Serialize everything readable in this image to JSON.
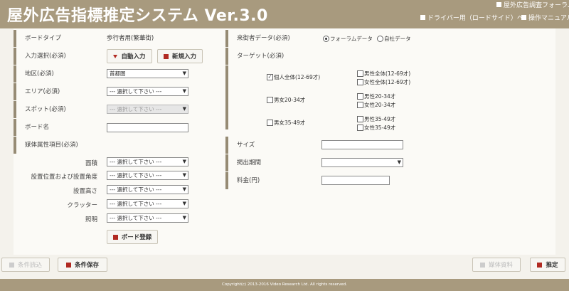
{
  "header": {
    "title": "屋外広告指標推定システム Ver.3.0",
    "link_forum": "屋外広告調査フォーラム",
    "link_driver": "ドライバー用（ロードサイド）へ",
    "link_manual": "操作マニュアル"
  },
  "form": {
    "board_type": {
      "label": "ボードタイプ",
      "value": "歩行者用(繁華街)"
    },
    "input_select": {
      "label": "入力選択(必須)",
      "auto_button": "自動入力",
      "new_button": "新規入力"
    },
    "region": {
      "label": "地区(必須)",
      "value": "首都圏"
    },
    "area": {
      "label": "エリア(必須)",
      "value": "--- 選択して下さい ---"
    },
    "spot": {
      "label": "スポット(必須)",
      "value": "--- 選択して下さい ---"
    },
    "board_name": {
      "label": "ボード名",
      "value": ""
    },
    "media_attrs": {
      "label": "媒体属性項目(必須)"
    },
    "attrs": [
      {
        "label": "面積",
        "value": "--- 選択して下さい ---"
      },
      {
        "label": "設置位置および設置角度",
        "value": "--- 選択して下さい ---"
      },
      {
        "label": "設置高さ",
        "value": "--- 選択して下さい ---"
      },
      {
        "label": "クラッター",
        "value": "--- 選択して下さい ---"
      },
      {
        "label": "照明",
        "value": "--- 選択して下さい ---"
      }
    ],
    "board_register_button": "ボード登録"
  },
  "right": {
    "traffic_data": {
      "label": "来街者データ(必須)",
      "options": [
        "フォーラムデータ",
        "自社データ"
      ],
      "selected": "フォーラムデータ"
    },
    "target": {
      "label": "ターゲット(必須)",
      "checkboxes": [
        {
          "label": "個人全体(12-69才)",
          "checked": true
        },
        {
          "label": "男性全体(12-69才)",
          "checked": false
        },
        {
          "label": "女性全体(12-69才)",
          "checked": false
        },
        {
          "label": "男女20-34才",
          "checked": false
        },
        {
          "label": "男性20-34才",
          "checked": false
        },
        {
          "label": "女性20-34才",
          "checked": false
        },
        {
          "label": "男女35-49才",
          "checked": false
        },
        {
          "label": "男性35-49才",
          "checked": false
        },
        {
          "label": "女性35-49才",
          "checked": false
        }
      ]
    },
    "size": {
      "label": "サイズ",
      "value": ""
    },
    "period": {
      "label": "掲出期間",
      "value": ""
    },
    "fee": {
      "label": "料金(円)",
      "value": ""
    }
  },
  "actions": {
    "load_conditions": "条件読込",
    "save_conditions": "条件保存",
    "media_data": "媒体資料",
    "estimate": "推定"
  },
  "footer": {
    "copyright": "Copyright(c) 2013-2016 Video Research Ltd. All rights reserved."
  },
  "colors": {
    "header_bg": "#a89a7e",
    "accent_red": "#b12a22",
    "label_bar": "#968b74"
  }
}
